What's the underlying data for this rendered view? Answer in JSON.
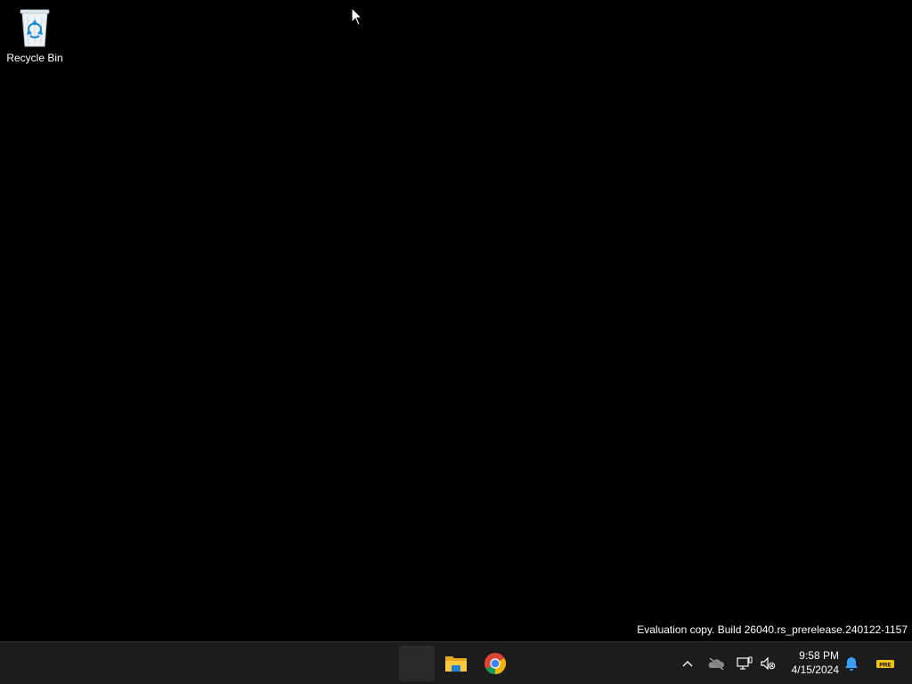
{
  "desktop": {
    "icons": [
      {
        "label": "Recycle Bin",
        "icon": "recycle-bin-icon"
      }
    ]
  },
  "watermark": {
    "text": "Evaluation copy. Build 26040.rs_prerelease.240122-1157"
  },
  "taskbar": {
    "apps": [
      {
        "name": "start",
        "icon": "start-icon"
      },
      {
        "name": "file-explorer",
        "icon": "folder-icon"
      },
      {
        "name": "chrome",
        "icon": "chrome-icon"
      }
    ],
    "tray": {
      "icons": [
        "chevron-up-icon",
        "onedrive-off-icon",
        "network-icon",
        "volume-muted-icon",
        "bell-icon",
        "pre-badge-icon"
      ],
      "time": "9:58 PM",
      "date": "4/15/2024",
      "badge_text": "PRE"
    }
  },
  "colors": {
    "background": "#000000",
    "taskbar": "#1c1c1c",
    "accent_blue": "#3aa0ff",
    "badge_yellow": "#f2c41c"
  }
}
